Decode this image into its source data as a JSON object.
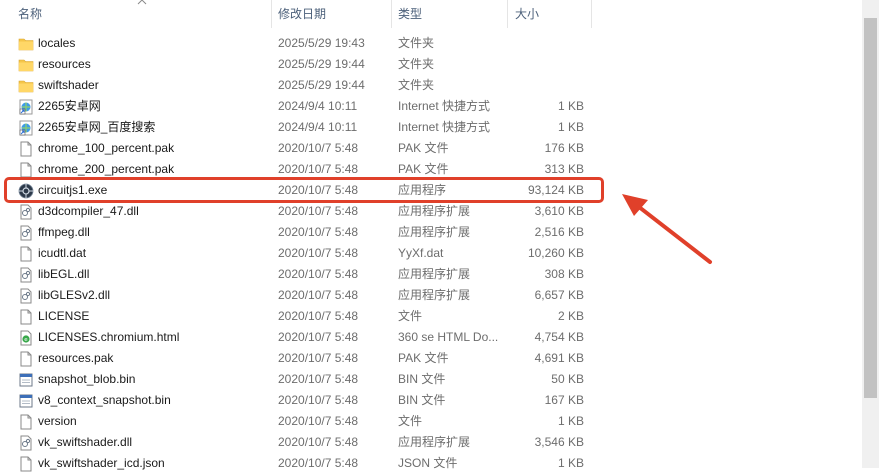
{
  "columns": {
    "name": "名称",
    "date": "修改日期",
    "type": "类型",
    "size": "大小"
  },
  "files": [
    {
      "name": "locales",
      "date": "2025/5/29 19:43",
      "type": "文件夹",
      "size": "",
      "icon": "folder-icon"
    },
    {
      "name": "resources",
      "date": "2025/5/29 19:44",
      "type": "文件夹",
      "size": "",
      "icon": "folder-icon"
    },
    {
      "name": "swiftshader",
      "date": "2025/5/29 19:44",
      "type": "文件夹",
      "size": "",
      "icon": "folder-icon"
    },
    {
      "name": "2265安卓网",
      "date": "2024/9/4 10:11",
      "type": "Internet 快捷方式",
      "size": "1 KB",
      "icon": "internet-shortcut-icon"
    },
    {
      "name": "2265安卓网_百度搜索",
      "date": "2024/9/4 10:11",
      "type": "Internet 快捷方式",
      "size": "1 KB",
      "icon": "internet-shortcut-icon"
    },
    {
      "name": "chrome_100_percent.pak",
      "date": "2020/10/7 5:48",
      "type": "PAK 文件",
      "size": "176 KB",
      "icon": "file-icon"
    },
    {
      "name": "chrome_200_percent.pak",
      "date": "2020/10/7 5:48",
      "type": "PAK 文件",
      "size": "313 KB",
      "icon": "file-icon"
    },
    {
      "name": "circuitjs1.exe",
      "date": "2020/10/7 5:48",
      "type": "应用程序",
      "size": "93,124 KB",
      "icon": "app-icon"
    },
    {
      "name": "d3dcompiler_47.dll",
      "date": "2020/10/7 5:48",
      "type": "应用程序扩展",
      "size": "3,610 KB",
      "icon": "dll-icon"
    },
    {
      "name": "ffmpeg.dll",
      "date": "2020/10/7 5:48",
      "type": "应用程序扩展",
      "size": "2,516 KB",
      "icon": "dll-icon"
    },
    {
      "name": "icudtl.dat",
      "date": "2020/10/7 5:48",
      "type": "YyXf.dat",
      "size": "10,260 KB",
      "icon": "file-icon"
    },
    {
      "name": "libEGL.dll",
      "date": "2020/10/7 5:48",
      "type": "应用程序扩展",
      "size": "308 KB",
      "icon": "dll-icon"
    },
    {
      "name": "libGLESv2.dll",
      "date": "2020/10/7 5:48",
      "type": "应用程序扩展",
      "size": "6,657 KB",
      "icon": "dll-icon"
    },
    {
      "name": "LICENSE",
      "date": "2020/10/7 5:48",
      "type": "文件",
      "size": "2 KB",
      "icon": "file-icon"
    },
    {
      "name": "LICENSES.chromium.html",
      "date": "2020/10/7 5:48",
      "type": "360 se HTML Do...",
      "size": "4,754 KB",
      "icon": "html-icon"
    },
    {
      "name": "resources.pak",
      "date": "2020/10/7 5:48",
      "type": "PAK 文件",
      "size": "4,691 KB",
      "icon": "file-icon"
    },
    {
      "name": "snapshot_blob.bin",
      "date": "2020/10/7 5:48",
      "type": "BIN 文件",
      "size": "50 KB",
      "icon": "bin-icon"
    },
    {
      "name": "v8_context_snapshot.bin",
      "date": "2020/10/7 5:48",
      "type": "BIN 文件",
      "size": "167 KB",
      "icon": "bin-icon"
    },
    {
      "name": "version",
      "date": "2020/10/7 5:48",
      "type": "文件",
      "size": "1 KB",
      "icon": "file-icon"
    },
    {
      "name": "vk_swiftshader.dll",
      "date": "2020/10/7 5:48",
      "type": "应用程序扩展",
      "size": "3,546 KB",
      "icon": "dll-icon"
    },
    {
      "name": "vk_swiftshader_icd.json",
      "date": "2020/10/7 5:48",
      "type": "JSON 文件",
      "size": "1 KB",
      "icon": "file-icon"
    }
  ],
  "highlighted_file": "circuitjs1.exe",
  "colors": {
    "highlight": "#e0402a",
    "folder": "#f5c64a",
    "header_text": "#4c607a"
  }
}
